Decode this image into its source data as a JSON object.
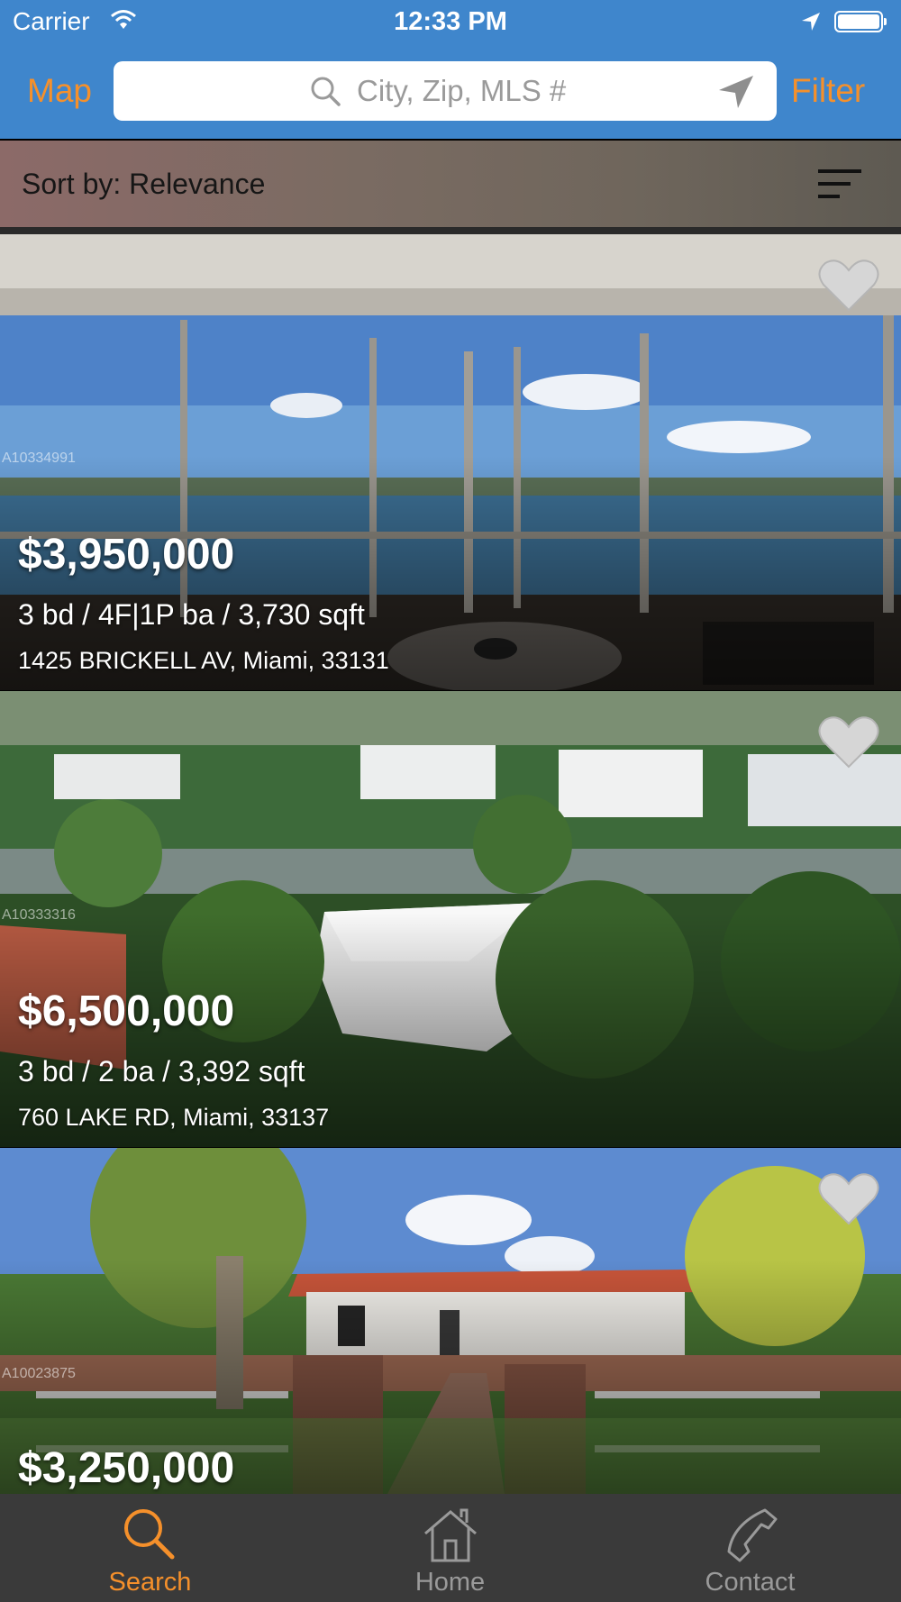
{
  "status_bar": {
    "carrier": "Carrier",
    "time": "12:33 PM",
    "icons": [
      "wifi-icon",
      "location-arrow-icon",
      "battery-icon"
    ]
  },
  "nav": {
    "map_label": "Map",
    "filter_label": "Filter",
    "search_placeholder": "City, Zip, MLS #",
    "accent_color": "#f5902b",
    "bar_color": "#3f86cc"
  },
  "sort": {
    "label": "Sort by: Relevance"
  },
  "listings": [
    {
      "price": "$3,950,000",
      "specs": "3 bd / 4F|1P ba / 3,730 sqft",
      "address": "1425 BRICKELL AV, Miami, 33131",
      "mls": "A10334991",
      "favorited": false
    },
    {
      "price": "$6,500,000",
      "specs": "3 bd / 2 ba / 3,392 sqft",
      "address": "760 LAKE RD, Miami, 33137",
      "mls": "A10333316",
      "favorited": false
    },
    {
      "price": "$3,250,000",
      "specs": "",
      "address": "",
      "mls": "A10023875",
      "favorited": false
    }
  ],
  "tabs": [
    {
      "label": "Search",
      "icon": "search-icon",
      "active": true,
      "color": "#f5902b"
    },
    {
      "label": "Home",
      "icon": "home-icon",
      "active": false,
      "color": "#9a9a9a"
    },
    {
      "label": "Contact",
      "icon": "phone-icon",
      "active": false,
      "color": "#9a9a9a"
    }
  ]
}
